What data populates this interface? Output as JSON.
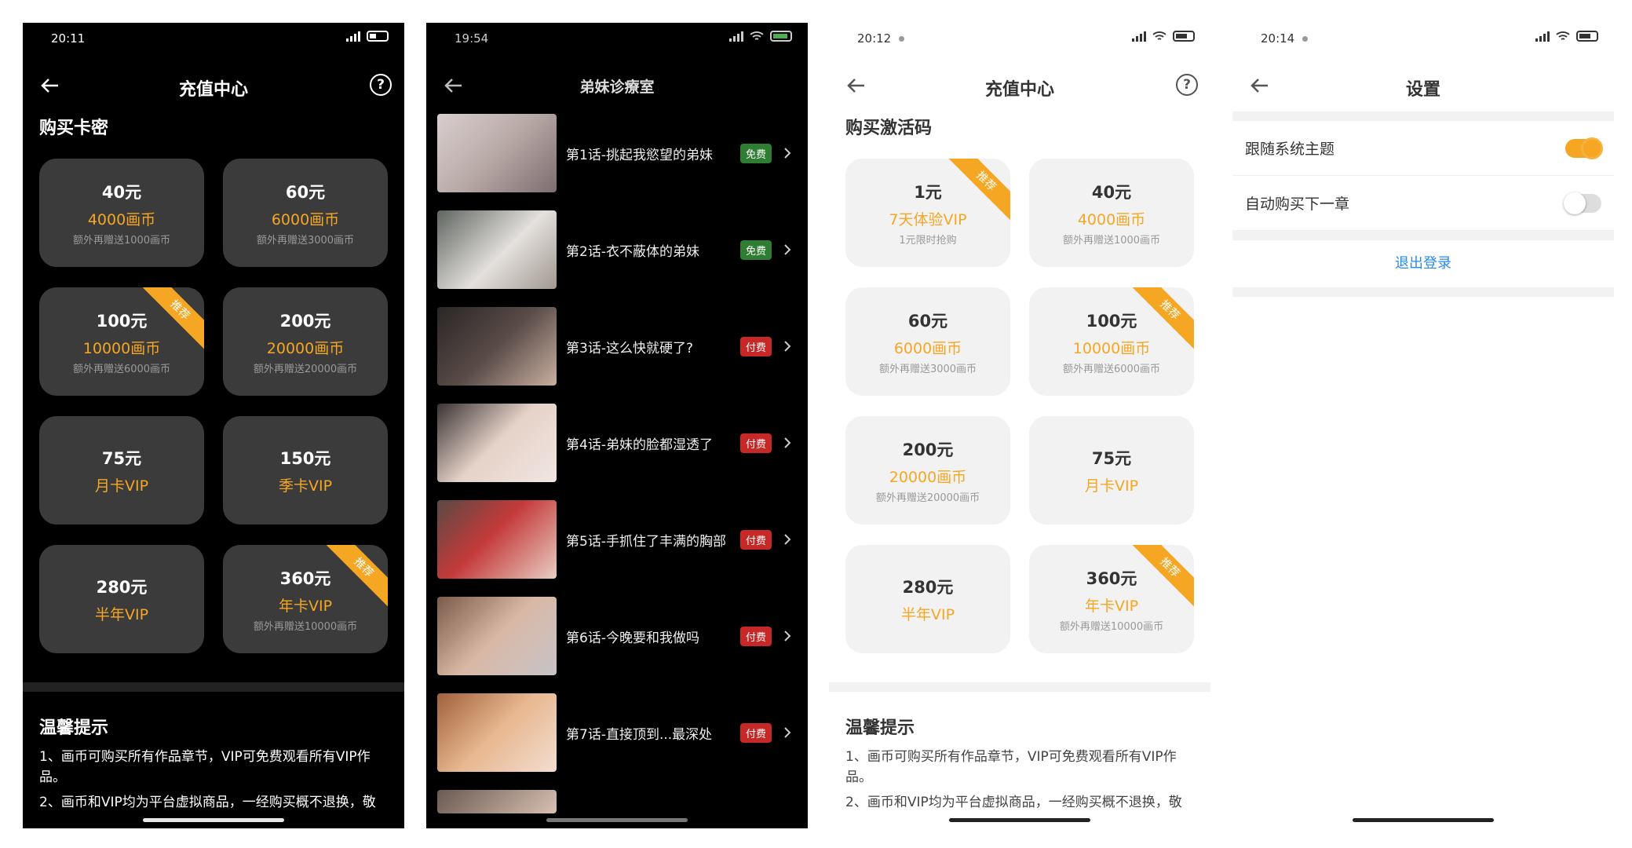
{
  "colors": {
    "accent": "#f5a623",
    "free": "#2e7d32",
    "paid": "#c62828",
    "link": "#2b8be6"
  },
  "screen1": {
    "time": "20:11",
    "title": "充值中心",
    "section": "购买卡密",
    "cards": [
      {
        "price": "40元",
        "desc": "4000画币",
        "note": "额外再赠送1000画币",
        "recommend": false
      },
      {
        "price": "60元",
        "desc": "6000画币",
        "note": "额外再赠送3000画币",
        "recommend": false
      },
      {
        "price": "100元",
        "desc": "10000画币",
        "note": "额外再赠送6000画币",
        "recommend": true
      },
      {
        "price": "200元",
        "desc": "20000画币",
        "note": "额外再赠送20000画币",
        "recommend": false
      },
      {
        "price": "75元",
        "desc": "月卡VIP",
        "note": "",
        "recommend": false
      },
      {
        "price": "150元",
        "desc": "季卡VIP",
        "note": "",
        "recommend": false
      },
      {
        "price": "280元",
        "desc": "半年VIP",
        "note": "",
        "recommend": false
      },
      {
        "price": "360元",
        "desc": "年卡VIP",
        "note": "额外再赠送10000画币",
        "recommend": true
      }
    ],
    "ribbon": "推荐",
    "tips_title": "温馨提示",
    "tips": [
      "1、画币可购买所有作品章节，VIP可免费观看所有VIP作品。",
      "2、画币和VIP均为平台虚拟商品，一经购买概不退换，敬"
    ]
  },
  "screen2": {
    "time": "19:54",
    "title": "弟妹诊療室",
    "chapters": [
      {
        "title": "第1话-挑起我慾望的弟妹",
        "badge": "免费",
        "type": "free"
      },
      {
        "title": "第2话-衣不蔽体的弟妹",
        "badge": "免费",
        "type": "free"
      },
      {
        "title": "第3话-这么快就硬了?",
        "badge": "付费",
        "type": "paid"
      },
      {
        "title": "第4话-弟妹的脸都湿透了",
        "badge": "付费",
        "type": "paid"
      },
      {
        "title": "第5话-手抓住了丰满的胸部",
        "badge": "付费",
        "type": "paid"
      },
      {
        "title": "第6话-今晚要和我做吗",
        "badge": "付费",
        "type": "paid"
      },
      {
        "title": "第7话-直接顶到...最深处",
        "badge": "付费",
        "type": "paid"
      }
    ]
  },
  "screen3": {
    "time": "20:12",
    "title": "充值中心",
    "section": "购买激活码",
    "cards": [
      {
        "price": "1元",
        "desc": "7天体验VIP",
        "note": "1元限时抢购",
        "recommend": true
      },
      {
        "price": "40元",
        "desc": "4000画币",
        "note": "额外再赠送1000画币",
        "recommend": false
      },
      {
        "price": "60元",
        "desc": "6000画币",
        "note": "额外再赠送3000画币",
        "recommend": false
      },
      {
        "price": "100元",
        "desc": "10000画币",
        "note": "额外再赠送6000画币",
        "recommend": true
      },
      {
        "price": "200元",
        "desc": "20000画币",
        "note": "额外再赠送20000画币",
        "recommend": false
      },
      {
        "price": "75元",
        "desc": "月卡VIP",
        "note": "",
        "recommend": false
      },
      {
        "price": "280元",
        "desc": "半年VIP",
        "note": "",
        "recommend": false
      },
      {
        "price": "360元",
        "desc": "年卡VIP",
        "note": "额外再赠送10000画币",
        "recommend": true
      }
    ],
    "ribbon": "推荐",
    "tips_title": "温馨提示",
    "tips": [
      "1、画币可购买所有作品章节，VIP可免费观看所有VIP作品。",
      "2、画币和VIP均为平台虚拟商品，一经购买概不退换，敬"
    ]
  },
  "screen4": {
    "time": "20:14",
    "title": "设置",
    "follow_theme": "跟随系统主题",
    "follow_theme_on": true,
    "auto_buy": "自动购买下一章",
    "auto_buy_on": false,
    "logout": "退出登录"
  }
}
